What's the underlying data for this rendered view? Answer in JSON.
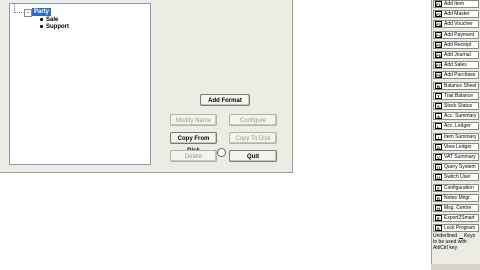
{
  "tree": {
    "root": "Party",
    "children": [
      "Sale",
      "Support"
    ]
  },
  "buttons": {
    "add_format": "Add Format",
    "modify_name": "Modify Name",
    "configure": "Configure",
    "copy_from_disk": "Copy From Disk",
    "copy_to_disk": "Copy To Disk",
    "delete": "Delete",
    "quit": "Quit"
  },
  "sidebar": {
    "items": [
      {
        "key": "F1",
        "label": "Add Item"
      },
      {
        "key": "F2",
        "label": "Add Master"
      },
      {
        "key": "F3",
        "label": "Add Voucher"
      },
      {
        "key": "F4",
        "label": "Add Payment"
      },
      {
        "key": "F5",
        "label": "Add Receipt"
      },
      {
        "key": "F6",
        "label": "Add Journal"
      },
      {
        "key": "F7",
        "label": "Add Sales"
      },
      {
        "key": "F8",
        "label": "Add Purchase"
      },
      {
        "key": "B",
        "label": "Balance Sheet"
      },
      {
        "key": "T",
        "label": "Trial Balance"
      },
      {
        "key": "S",
        "label": "Stock Status"
      },
      {
        "key": "A",
        "label": "Acc. Summary"
      },
      {
        "key": "L",
        "label": "Acc. Ledger"
      },
      {
        "key": "I",
        "label": "Item Summary"
      },
      {
        "key": "D",
        "label": "View Ledger"
      },
      {
        "key": "V",
        "label": "VAT Summary"
      },
      {
        "key": "Q",
        "label": "Query System"
      },
      {
        "key": "U",
        "label": "Switch User"
      },
      {
        "key": "F",
        "label": "Configuration"
      },
      {
        "key": "R",
        "label": "Notes Mngr."
      },
      {
        "key": "H",
        "label": "Msg. Centre"
      },
      {
        "key": "E",
        "label": "Export2Smart"
      },
      {
        "key": "K",
        "label": "Lock Program"
      }
    ],
    "note_pre": "Underlined",
    "note_post": "Keys to be used with Alt/Ctrl key"
  }
}
